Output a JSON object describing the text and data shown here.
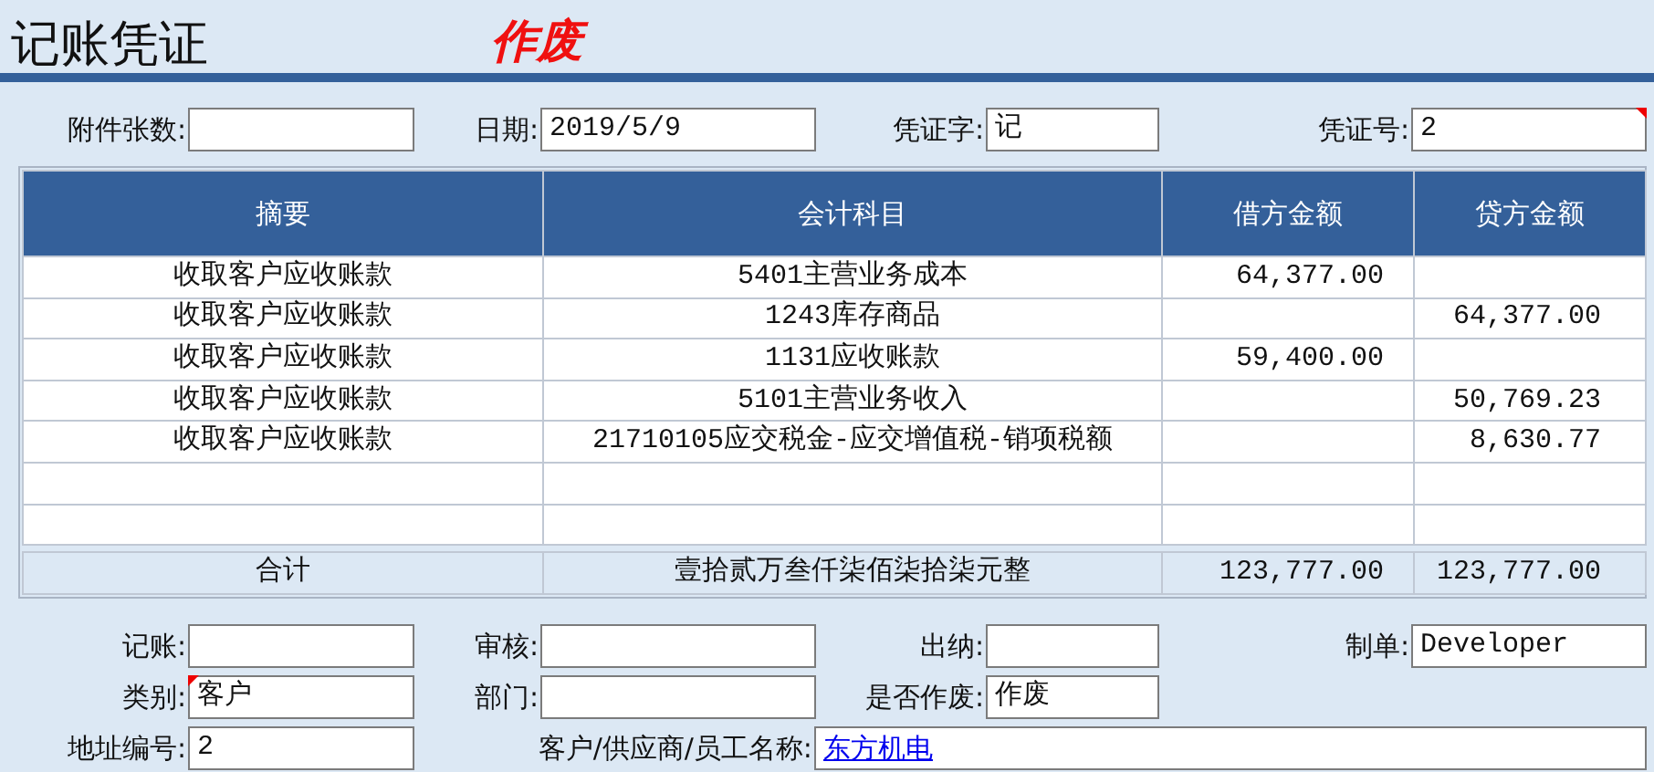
{
  "header": {
    "title": "记账凭证",
    "status": "作废"
  },
  "top_fields": [
    {
      "label": "附件张数:",
      "flagged": false
    },
    {
      "label": "日期:",
      "value": "2019/5/9",
      "flagged": false
    },
    {
      "label": "凭证字:",
      "value": "记",
      "flagged": false
    },
    {
      "label": "凭证号:",
      "value": "2",
      "flagged": true
    }
  ],
  "table": {
    "columns": [
      "摘要",
      "会计科目",
      "借方金额",
      "贷方金额"
    ],
    "rows": [
      {
        "summary": "收取客户应收账款",
        "account": "5401主营业务成本",
        "debit": "64,377.00"
      },
      {
        "summary": "收取客户应收账款",
        "account": "1243库存商品",
        "credit": "64,377.00"
      },
      {
        "summary": "收取客户应收账款",
        "account": "1131应收账款",
        "debit": "59,400.00"
      },
      {
        "summary": "收取客户应收账款",
        "account": "5101主营业务收入",
        "credit": "50,769.23"
      },
      {
        "summary": "收取客户应收账款",
        "account": "21710105应交税金-应交增值税-销项税额",
        "credit": "8,630.77"
      }
    ],
    "total": {
      "label": "合计",
      "amount_in_words": "壹拾贰万叁仟柒佰柒拾柒元整",
      "debit": "123,777.00",
      "credit": "123,777.00"
    }
  },
  "bottom_rows": [
    [
      {
        "label": "记账:",
        "flagged": false
      },
      {
        "label": "审核:",
        "flagged": false
      },
      {
        "label": "出纳:",
        "flagged": false
      },
      {
        "label": "制单:",
        "value": "Developer",
        "flagged": false
      }
    ],
    [
      {
        "label": "类别:",
        "value": "客户",
        "flagged": true
      },
      {
        "label": "部门:",
        "flagged": false
      },
      {
        "label": "是否作废:",
        "value": "作废",
        "flagged": false
      }
    ],
    [
      {
        "label": "地址编号:",
        "value": "2",
        "flagged": false
      },
      {
        "label": "客户/供应商/员工名称:",
        "value": "东方机电",
        "kind": "link",
        "flagged": false
      }
    ]
  ]
}
